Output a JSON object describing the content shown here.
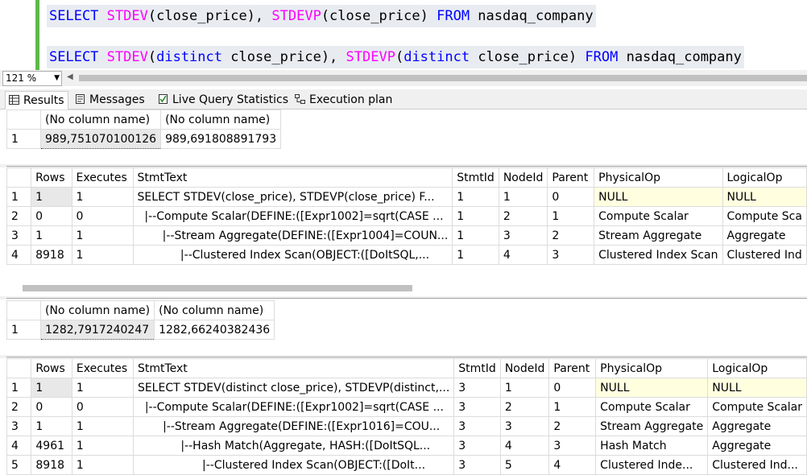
{
  "editor": {
    "line1": {
      "kw1": "SELECT",
      "fn1": "STDEV",
      "p1": "(close_price), ",
      "fn2": "STDEVP",
      "p2": "(close_price) ",
      "kw2": "FROM",
      "p3": " nasdaq_company"
    },
    "line2": {
      "kw1": "SELECT",
      "fn1": "STDEV",
      "p1": "(",
      "kw_d1": "distinct",
      "p2": " close_price), ",
      "fn2": "STDEVP",
      "p3": "(",
      "kw_d2": "distinct",
      "p4": " close_price) ",
      "kw2": "FROM",
      "p5": " nasdaq_company"
    }
  },
  "zoom": {
    "value": "121 %"
  },
  "tabs": [
    {
      "label": "Results",
      "icon": "grid-icon"
    },
    {
      "label": "Messages",
      "icon": "messages-icon"
    },
    {
      "label": "Live Query Statistics",
      "icon": "live-stats-icon"
    },
    {
      "label": "Execution plan",
      "icon": "execution-plan-icon"
    }
  ],
  "result1": {
    "headers": [
      "(No column name)",
      "(No column name)"
    ],
    "rows": [
      [
        "1",
        "989,751070100126",
        "989,691808891793"
      ]
    ]
  },
  "stats1": {
    "headers": [
      "Rows",
      "Executes",
      "StmtText",
      "StmtId",
      "NodeId",
      "Parent",
      "PhysicalOp",
      "LogicalOp"
    ],
    "rows": [
      [
        "1",
        "1",
        "1",
        "SELECT STDEV(close_price), STDEVP(close_price) F...",
        "1",
        "1",
        "0",
        "NULL",
        "NULL"
      ],
      [
        "2",
        "0",
        "0",
        "  |--Compute Scalar(DEFINE:([Expr1002]=sqrt(CASE ...",
        "1",
        "2",
        "1",
        "Compute Scalar",
        "Compute Sca"
      ],
      [
        "3",
        "1",
        "1",
        "       |--Stream Aggregate(DEFINE:([Expr1004]=COUN...",
        "1",
        "3",
        "2",
        "Stream Aggregate",
        "Aggregate"
      ],
      [
        "4",
        "8918",
        "1",
        "            |--Clustered Index Scan(OBJECT:([DoItSQL,...",
        "1",
        "4",
        "3",
        "Clustered Index Scan",
        "Clustered Ind"
      ]
    ]
  },
  "result2": {
    "headers": [
      "(No column name)",
      "(No column name)"
    ],
    "rows": [
      [
        "1",
        "1282,7917240247",
        "1282,66240382436"
      ]
    ]
  },
  "stats2": {
    "headers": [
      "Rows",
      "Executes",
      "StmtText",
      "StmtId",
      "NodeId",
      "Parent",
      "PhysicalOp",
      "LogicalOp"
    ],
    "rows": [
      [
        "1",
        "1",
        "1",
        "SELECT STDEV(distinct close_price), STDEVP(distinct,...",
        "3",
        "1",
        "0",
        "NULL",
        "NULL"
      ],
      [
        "2",
        "0",
        "0",
        "  |--Compute Scalar(DEFINE:([Expr1002]=sqrt(CASE ...",
        "3",
        "2",
        "1",
        "Compute Scalar",
        "Compute Scalar"
      ],
      [
        "3",
        "1",
        "1",
        "       |--Stream Aggregate(DEFINE:([Expr1016]=COU...",
        "3",
        "3",
        "2",
        "Stream Aggregate",
        "Aggregate"
      ],
      [
        "4",
        "4961",
        "1",
        "            |--Hash Match(Aggregate, HASH:([DoItSQL...",
        "3",
        "4",
        "3",
        "Hash Match",
        "Aggregate"
      ],
      [
        "5",
        "8918",
        "1",
        "                  |--Clustered Index Scan(OBJECT:([DoIt...",
        "3",
        "5",
        "4",
        "Clustered Inde...",
        "Clustered Ind..."
      ]
    ]
  }
}
